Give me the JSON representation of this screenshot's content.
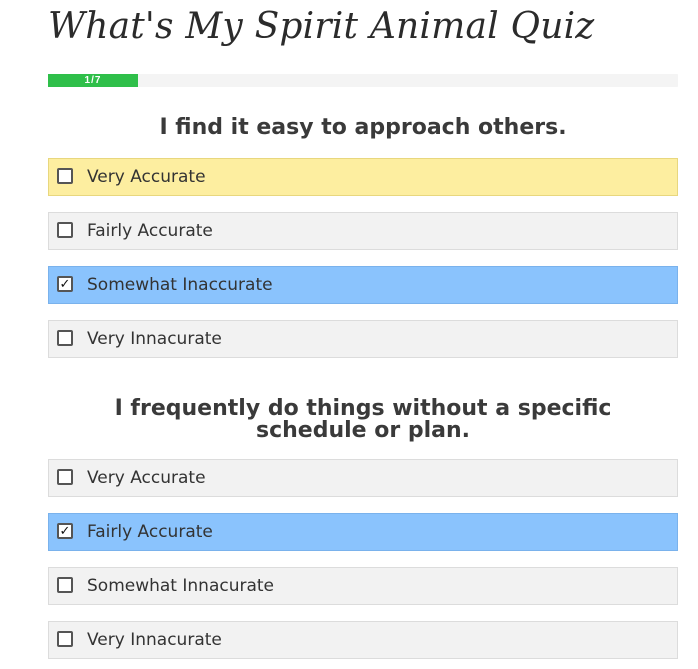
{
  "quiz": {
    "title": "What's My Spirit Animal Quiz",
    "progress": {
      "label": "1/7",
      "current": 1,
      "total": 7
    }
  },
  "questions": [
    {
      "text": "I find it easy to approach others.",
      "options": [
        {
          "label": "Very Accurate",
          "checked": false,
          "state": "hover"
        },
        {
          "label": "Fairly Accurate",
          "checked": false,
          "state": "default"
        },
        {
          "label": "Somewhat Inaccurate",
          "checked": true,
          "state": "selected"
        },
        {
          "label": "Very Innacurate",
          "checked": false,
          "state": "default"
        }
      ]
    },
    {
      "text": "I frequently do things without a specific schedule or plan.",
      "options": [
        {
          "label": "Very Accurate",
          "checked": false,
          "state": "default"
        },
        {
          "label": "Fairly Accurate",
          "checked": true,
          "state": "selected"
        },
        {
          "label": "Somewhat Innacurate",
          "checked": false,
          "state": "default"
        },
        {
          "label": "Very Innacurate",
          "checked": false,
          "state": "default"
        }
      ]
    }
  ],
  "colors": {
    "progress": "#2fbf4a",
    "hover": "#fdeea0",
    "selected": "#8ac3fd",
    "default": "#f2f2f2"
  },
  "icons": {
    "checked": "checkbox-checked-icon",
    "unchecked": "checkbox-empty-icon"
  }
}
